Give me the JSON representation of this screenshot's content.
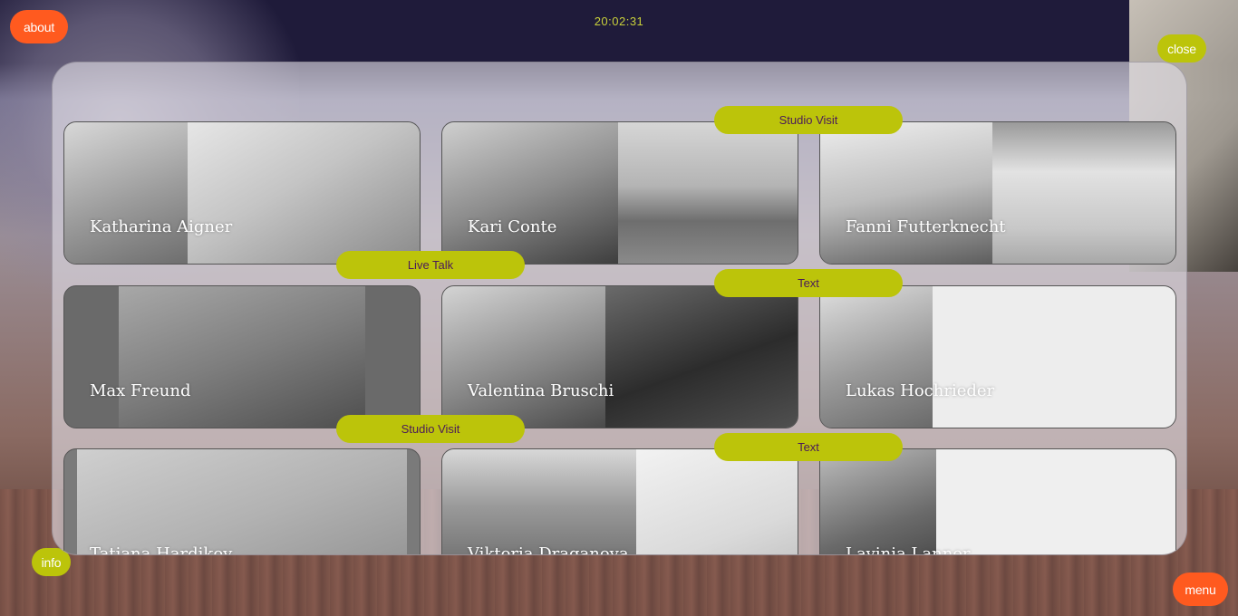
{
  "header": {
    "clock": "20:02:31"
  },
  "buttons": {
    "about": "about",
    "close": "close",
    "info": "info",
    "menu": "menu"
  },
  "cards": [
    {
      "name": "Katharina Aigner"
    },
    {
      "name": "Kari Conte"
    },
    {
      "name": "Fanni Futterknecht"
    },
    {
      "name": "Max Freund"
    },
    {
      "name": "Valentina Bruschi"
    },
    {
      "name": "Lukas Hochrieder"
    },
    {
      "name": "Tatiana Hardikov"
    },
    {
      "name": "Viktoria Draganova"
    },
    {
      "name": "Lavinia Lanner"
    }
  ],
  "tags": [
    {
      "label": "Studio Visit"
    },
    {
      "label": "Live Talk"
    },
    {
      "label": "Text"
    },
    {
      "label": "Studio Visit"
    },
    {
      "label": "Text"
    }
  ],
  "colors": {
    "orange": "#ff5a1f",
    "lime": "#bcc40a",
    "clock": "#c9d13a"
  }
}
